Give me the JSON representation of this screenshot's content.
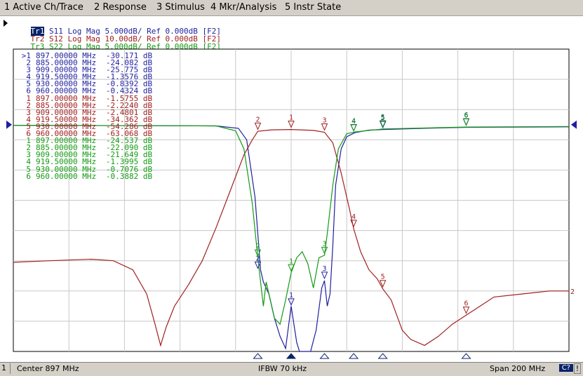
{
  "menu": [
    {
      "label": "1 Active Ch/Trace"
    },
    {
      "label": "2 Response"
    },
    {
      "label": "3 Stimulus"
    },
    {
      "label": "4 Mkr/Analysis"
    },
    {
      "label": "5 Instr State"
    }
  ],
  "traces": [
    {
      "id": "Tr1",
      "text": " S11 Log Mag 5.000dB/ Ref 0.000dB [F2]",
      "color": "#1f1fa0",
      "active": true
    },
    {
      "id": "Tr2",
      "text": " S12 Log Mag 10.00dB/ Ref 0.000dB [F2]",
      "color": "#a02020"
    },
    {
      "id": "Tr3",
      "text": " S22 Log Mag 5.000dB/ Ref 0.000dB [F2]",
      "color": "#139a13"
    }
  ],
  "marker_table": [
    {
      "id": ">1",
      "freq": "897.00000 MHz",
      "val": "-30.171 dB",
      "color": "#1f1fa0"
    },
    {
      "id": "2",
      "freq": "885.00000 MHz",
      "val": "-24.082 dB",
      "color": "#1f1fa0"
    },
    {
      "id": "3",
      "freq": "909.00000 MHz",
      "val": "-25.775 dB",
      "color": "#1f1fa0"
    },
    {
      "id": "4",
      "freq": "919.50000 MHz",
      "val": "-1.3576 dB",
      "color": "#1f1fa0"
    },
    {
      "id": "5",
      "freq": "930.00000 MHz",
      "val": "-0.8392 dB",
      "color": "#1f1fa0"
    },
    {
      "id": "6",
      "freq": "960.00000 MHz",
      "val": "-0.4324 dB",
      "color": "#1f1fa0"
    },
    {
      "id": "1",
      "freq": "897.00000 MHz",
      "val": "-1.5755 dB",
      "color": "#a02020"
    },
    {
      "id": "2",
      "freq": "885.00000 MHz",
      "val": "-2.2240 dB",
      "color": "#a02020"
    },
    {
      "id": "3",
      "freq": "909.00000 MHz",
      "val": "-2.4801 dB",
      "color": "#a02020"
    },
    {
      "id": "4",
      "freq": "919.50000 MHz",
      "val": "-34.362 dB",
      "color": "#a02020"
    },
    {
      "id": "5",
      "freq": "930.00000 MHz",
      "val": "-54.286 dB",
      "color": "#a02020"
    },
    {
      "id": "6",
      "freq": "960.00000 MHz",
      "val": "-63.068 dB",
      "color": "#a02020"
    },
    {
      "id": "1",
      "freq": "897.00000 MHz",
      "val": "-24.537 dB",
      "color": "#139a13"
    },
    {
      "id": "2",
      "freq": "885.00000 MHz",
      "val": "-22.090 dB",
      "color": "#139a13"
    },
    {
      "id": "3",
      "freq": "909.00000 MHz",
      "val": "-21.649 dB",
      "color": "#139a13"
    },
    {
      "id": "4",
      "freq": "919.50000 MHz",
      "val": "-1.3995 dB",
      "color": "#139a13"
    },
    {
      "id": "5",
      "freq": "930.00000 MHz",
      "val": "-0.7076 dB",
      "color": "#139a13"
    },
    {
      "id": "6",
      "freq": "960.00000 MHz",
      "val": "-0.3882 dB",
      "color": "#139a13"
    }
  ],
  "status": {
    "channel": "1",
    "center": "Center 897 MHz",
    "ifbw": "IFBW 70 kHz",
    "span": "Span 200 MHz",
    "cal": "C?",
    "alert": "!"
  },
  "chart_data": {
    "type": "line",
    "x_range_mhz": [
      797,
      997
    ],
    "grid": true,
    "divisions": {
      "x": 10,
      "y": 10
    },
    "reference_level_db": 0,
    "series": [
      {
        "trace": "Tr1",
        "name": "S11",
        "scale_db_per_div": 5,
        "color": "#1f1fa0",
        "points": [
          [
            797,
            -0.1
          ],
          [
            870,
            -0.2
          ],
          [
            878,
            -0.6
          ],
          [
            881,
            -2.5
          ],
          [
            884,
            -12
          ],
          [
            886,
            -24
          ],
          [
            887,
            -26
          ],
          [
            889,
            -28
          ],
          [
            891,
            -32
          ],
          [
            893,
            -35
          ],
          [
            895,
            -37
          ],
          [
            897,
            -30
          ],
          [
            899,
            -36
          ],
          [
            900,
            -41
          ],
          [
            901,
            -46
          ],
          [
            902,
            -50
          ],
          [
            903,
            -47
          ],
          [
            904,
            -42
          ],
          [
            906,
            -34
          ],
          [
            908,
            -27
          ],
          [
            909,
            -25.8
          ],
          [
            910,
            -30
          ],
          [
            911,
            -28
          ],
          [
            912,
            -20
          ],
          [
            913,
            -10
          ],
          [
            915,
            -4
          ],
          [
            917,
            -2
          ],
          [
            920,
            -1.3
          ],
          [
            925,
            -0.9
          ],
          [
            930,
            -0.8
          ],
          [
            945,
            -0.6
          ],
          [
            960,
            -0.43
          ],
          [
            997,
            -0.35
          ]
        ]
      },
      {
        "trace": "Tr2",
        "name": "S12",
        "scale_db_per_div": 10,
        "color": "#a02020",
        "points": [
          [
            797,
            -45.5
          ],
          [
            810,
            -45
          ],
          [
            825,
            -44.5
          ],
          [
            833,
            -45
          ],
          [
            840,
            -48
          ],
          [
            845,
            -56
          ],
          [
            848,
            -66
          ],
          [
            850,
            -73
          ],
          [
            852,
            -67
          ],
          [
            855,
            -60
          ],
          [
            860,
            -53
          ],
          [
            865,
            -45
          ],
          [
            870,
            -34
          ],
          [
            875,
            -22
          ],
          [
            880,
            -10
          ],
          [
            883,
            -5
          ],
          [
            885,
            -2.2
          ],
          [
            890,
            -1.7
          ],
          [
            897,
            -1.6
          ],
          [
            905,
            -1.9
          ],
          [
            909,
            -2.5
          ],
          [
            912,
            -6
          ],
          [
            915,
            -16
          ],
          [
            918,
            -28
          ],
          [
            919.5,
            -34.4
          ],
          [
            922,
            -42
          ],
          [
            925,
            -48
          ],
          [
            928,
            -51
          ],
          [
            930,
            -54.3
          ],
          [
            933,
            -58
          ],
          [
            935,
            -63
          ],
          [
            937,
            -68
          ],
          [
            940,
            -71
          ],
          [
            945,
            -73
          ],
          [
            950,
            -70
          ],
          [
            955,
            -66
          ],
          [
            960,
            -63
          ],
          [
            965,
            -60
          ],
          [
            970,
            -57
          ],
          [
            980,
            -56
          ],
          [
            990,
            -55
          ],
          [
            997,
            -55
          ]
        ]
      },
      {
        "trace": "Tr3",
        "name": "S22",
        "scale_db_per_div": 5,
        "color": "#139a13",
        "points": [
          [
            797,
            -0.1
          ],
          [
            870,
            -0.2
          ],
          [
            877,
            -1
          ],
          [
            880,
            -4
          ],
          [
            883,
            -13
          ],
          [
            885,
            -22
          ],
          [
            886,
            -26
          ],
          [
            887,
            -30
          ],
          [
            888,
            -26
          ],
          [
            889,
            -28
          ],
          [
            891,
            -32
          ],
          [
            893,
            -33
          ],
          [
            895,
            -29
          ],
          [
            897,
            -24.5
          ],
          [
            899,
            -22
          ],
          [
            901,
            -21
          ],
          [
            903,
            -23
          ],
          [
            905,
            -27
          ],
          [
            907,
            -22
          ],
          [
            909,
            -21.6
          ],
          [
            910,
            -18
          ],
          [
            912,
            -10
          ],
          [
            914,
            -4
          ],
          [
            917,
            -1.5
          ],
          [
            920,
            -1.2
          ],
          [
            930,
            -0.7
          ],
          [
            960,
            -0.39
          ],
          [
            997,
            -0.3
          ]
        ]
      }
    ],
    "markers": [
      {
        "trace": "Tr1",
        "labels": [
          "1",
          "2",
          "3",
          "4",
          "5",
          "6"
        ],
        "freq_mhz": [
          897,
          885,
          909,
          919.5,
          930,
          960
        ],
        "db": [
          -30.171,
          -24.082,
          -25.775,
          -1.3576,
          -0.8392,
          -0.4324
        ]
      },
      {
        "trace": "Tr2",
        "labels": [
          "1",
          "2",
          "3",
          "4",
          "5",
          "6"
        ],
        "freq_mhz": [
          897,
          885,
          909,
          919.5,
          930,
          960
        ],
        "db": [
          -1.5755,
          -2.224,
          -2.4801,
          -34.362,
          -54.286,
          -63.068
        ]
      },
      {
        "trace": "Tr3",
        "labels": [
          "1",
          "2",
          "3",
          "4",
          "5",
          "6"
        ],
        "freq_mhz": [
          897,
          885,
          909,
          919.5,
          930,
          960
        ],
        "db": [
          -24.537,
          -22.09,
          -21.649,
          -1.3995,
          -0.7076,
          -0.3882
        ]
      }
    ],
    "right_edge_label": "2"
  }
}
